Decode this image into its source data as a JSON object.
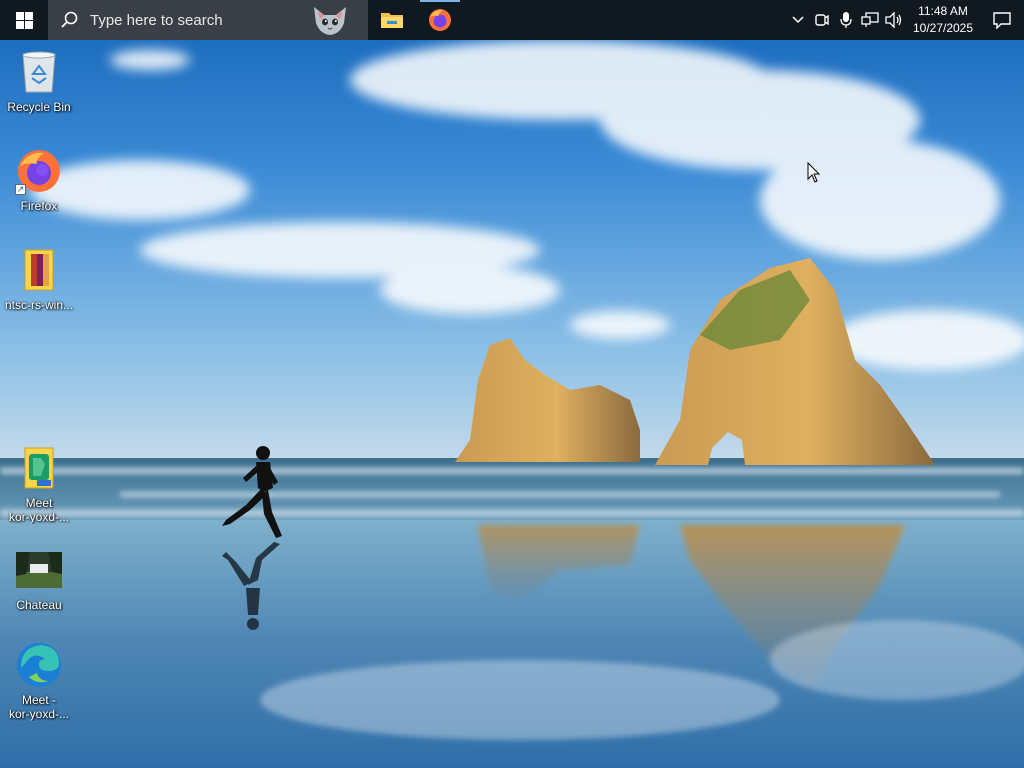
{
  "taskbar": {
    "search_placeholder": "Type here to search",
    "pinned": [
      {
        "name": "File Explorer",
        "icon": "folder-icon"
      },
      {
        "name": "Firefox",
        "icon": "firefox-icon",
        "active": true
      }
    ],
    "tray_icons": [
      "chevron-up-icon",
      "meet-now-icon",
      "microphone-icon",
      "network-icon",
      "volume-icon"
    ],
    "clock": {
      "time": "11:48 AM",
      "date": "10/27/2025"
    },
    "accent": "#101820"
  },
  "desktop": {
    "icons": [
      {
        "label": "Recycle Bin",
        "icon": "recycle-bin-icon"
      },
      {
        "label": "Firefox",
        "icon": "firefox-icon"
      },
      {
        "label": "ntsc-rs-win...",
        "icon": "archive-icon"
      },
      {
        "label": "Meet\nkor-yoxd-...",
        "icon": "meet-file-icon"
      },
      {
        "label": "Chateau",
        "icon": "photo-thumbnail-icon"
      },
      {
        "label": "Meet -\nkor-yoxd-...",
        "icon": "edge-icon"
      }
    ]
  }
}
